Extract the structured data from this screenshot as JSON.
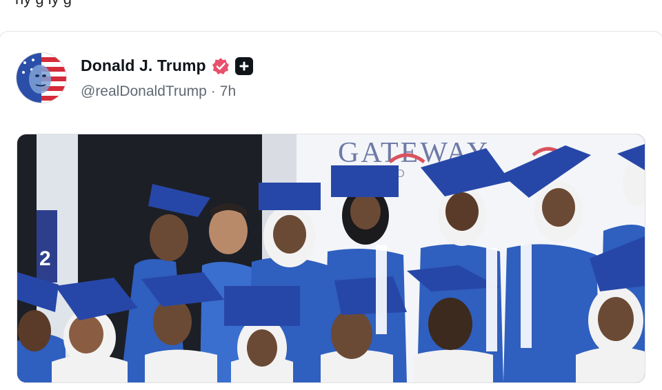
{
  "previous_post": {
    "text_fragment": "ny g      ly         g     "
  },
  "post": {
    "author": {
      "name": "Donald J. Trump",
      "handle": "@realDonaldTrump",
      "separator": "·",
      "time": "7h"
    },
    "media": {
      "banner_text": "GATEWAY",
      "banner_subtext": "E     E   D",
      "class_sign": "2"
    }
  },
  "colors": {
    "verified": "#e8506b",
    "gown": "#2f5fbf",
    "cap": "#2747a8",
    "background_dark": "#1c1f26"
  },
  "icons": [
    "verified-badge-icon",
    "plus-badge-icon"
  ]
}
